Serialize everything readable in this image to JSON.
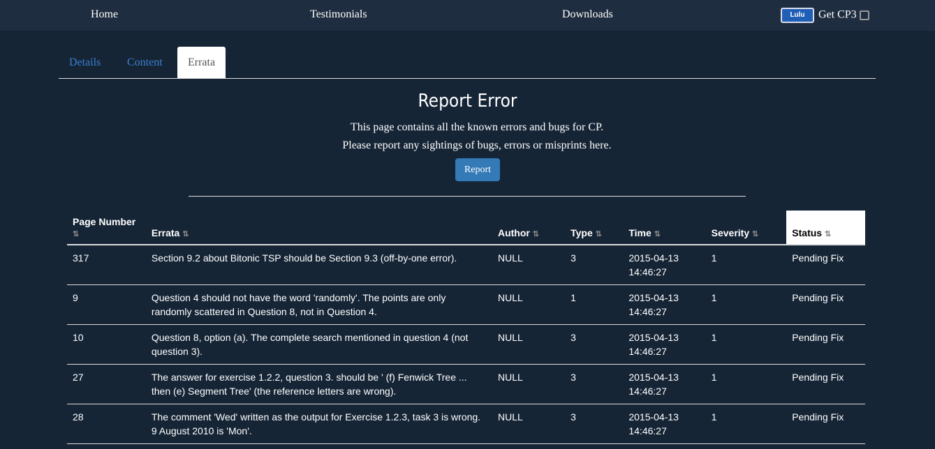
{
  "nav": {
    "home": "Home",
    "testimonials": "Testimonials",
    "downloads": "Downloads",
    "lulu": "Lulu",
    "get": "Get CP3"
  },
  "tabs": [
    "Details",
    "Content",
    "Errata"
  ],
  "title": "Report Error",
  "desc": [
    "This page contains all the known errors and bugs for CP.",
    "Please report any sightings of bugs, errors or misprints here."
  ],
  "report": "Report",
  "sort_icon": "⇅",
  "headers": [
    "Page Number",
    "Errata",
    "Author",
    "Type",
    "Time",
    "Severity",
    "Status"
  ],
  "rows": [
    [
      "317",
      "Section 9.2 about Bitonic TSP should be Section 9.3 (off-by-one error).",
      "NULL",
      "3",
      "2015-04-13 14:46:27",
      "1",
      "Pending Fix"
    ],
    [
      "9",
      "Question 4 should not have the word 'randomly'. The points are only randomly scattered in Question 8, not in Question 4.",
      "NULL",
      "1",
      "2015-04-13 14:46:27",
      "1",
      "Pending Fix"
    ],
    [
      "10",
      "Question 8, option (a). The complete search mentioned in question 4 (not question 3).",
      "NULL",
      "3",
      "2015-04-13 14:46:27",
      "1",
      "Pending Fix"
    ],
    [
      "27",
      "The answer for exercise 1.2.2, question 3. should be ' (f) Fenwick Tree ... then (e) Segment Tree' (the reference letters are wrong).",
      "NULL",
      "3",
      "2015-04-13 14:46:27",
      "1",
      "Pending Fix"
    ],
    [
      "28",
      "The comment 'Wed' written as the output for Exercise 1.2.3, task 3 is wrong. 9 August 2010 is 'Mon'.",
      "NULL",
      "3",
      "2015-04-13 14:46:27",
      "1",
      "Pending Fix"
    ]
  ]
}
